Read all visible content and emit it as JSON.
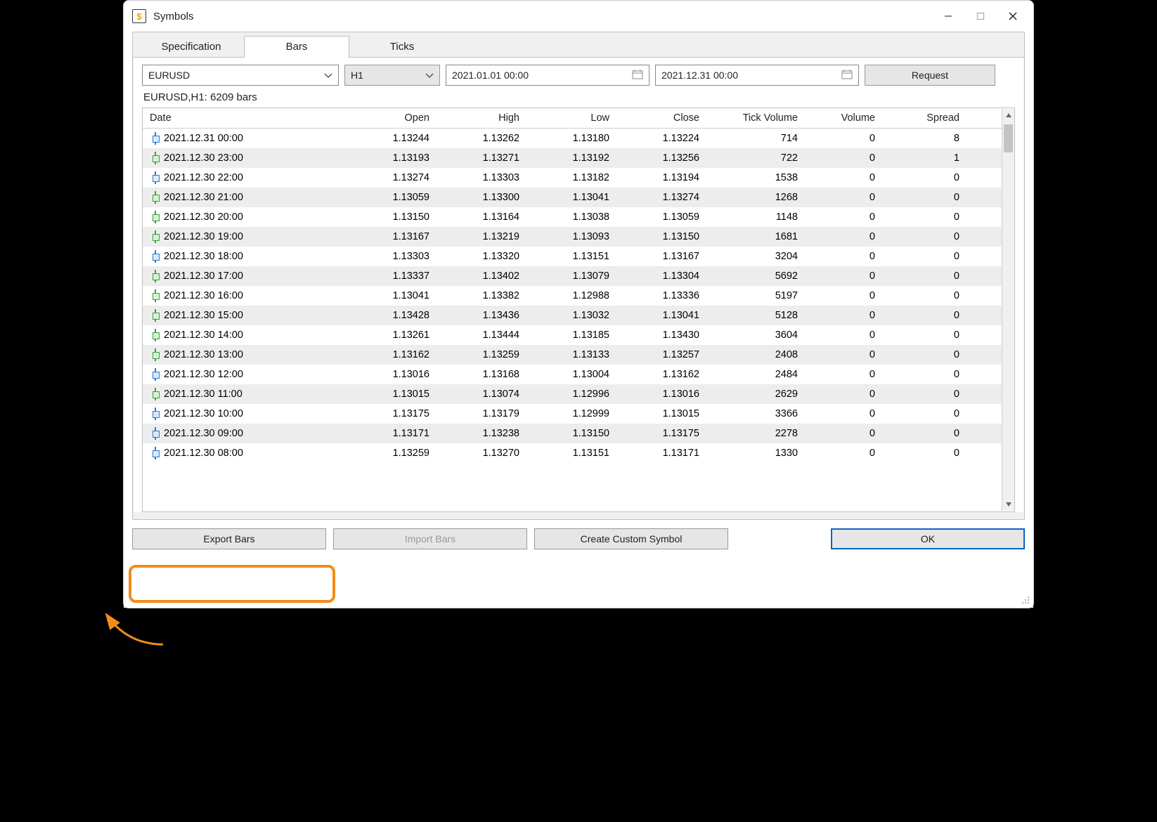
{
  "window": {
    "title": "Symbols"
  },
  "tabs": [
    {
      "label": "Specification",
      "active": false
    },
    {
      "label": "Bars",
      "active": true
    },
    {
      "label": "Ticks",
      "active": false
    }
  ],
  "filters": {
    "symbol": "EURUSD",
    "timeframe": "H1",
    "from": "2021.01.01 00:00",
    "to": "2021.12.31 00:00",
    "request_label": "Request"
  },
  "status_line": "EURUSD,H1: 6209 bars",
  "columns": [
    "Date",
    "Open",
    "High",
    "Low",
    "Close",
    "Tick Volume",
    "Volume",
    "Spread"
  ],
  "rows": [
    {
      "dir": "down",
      "date": "2021.12.31 00:00",
      "open": "1.13244",
      "high": "1.13262",
      "low": "1.13180",
      "close": "1.13224",
      "tv": "714",
      "vol": "0",
      "spr": "8"
    },
    {
      "dir": "up",
      "date": "2021.12.30 23:00",
      "open": "1.13193",
      "high": "1.13271",
      "low": "1.13192",
      "close": "1.13256",
      "tv": "722",
      "vol": "0",
      "spr": "1"
    },
    {
      "dir": "down",
      "date": "2021.12.30 22:00",
      "open": "1.13274",
      "high": "1.13303",
      "low": "1.13182",
      "close": "1.13194",
      "tv": "1538",
      "vol": "0",
      "spr": "0"
    },
    {
      "dir": "up",
      "date": "2021.12.30 21:00",
      "open": "1.13059",
      "high": "1.13300",
      "low": "1.13041",
      "close": "1.13274",
      "tv": "1268",
      "vol": "0",
      "spr": "0"
    },
    {
      "dir": "up",
      "date": "2021.12.30 20:00",
      "open": "1.13150",
      "high": "1.13164",
      "low": "1.13038",
      "close": "1.13059",
      "tv": "1148",
      "vol": "0",
      "spr": "0"
    },
    {
      "dir": "up",
      "date": "2021.12.30 19:00",
      "open": "1.13167",
      "high": "1.13219",
      "low": "1.13093",
      "close": "1.13150",
      "tv": "1681",
      "vol": "0",
      "spr": "0"
    },
    {
      "dir": "down",
      "date": "2021.12.30 18:00",
      "open": "1.13303",
      "high": "1.13320",
      "low": "1.13151",
      "close": "1.13167",
      "tv": "3204",
      "vol": "0",
      "spr": "0"
    },
    {
      "dir": "up",
      "date": "2021.12.30 17:00",
      "open": "1.13337",
      "high": "1.13402",
      "low": "1.13079",
      "close": "1.13304",
      "tv": "5692",
      "vol": "0",
      "spr": "0"
    },
    {
      "dir": "up",
      "date": "2021.12.30 16:00",
      "open": "1.13041",
      "high": "1.13382",
      "low": "1.12988",
      "close": "1.13336",
      "tv": "5197",
      "vol": "0",
      "spr": "0"
    },
    {
      "dir": "up",
      "date": "2021.12.30 15:00",
      "open": "1.13428",
      "high": "1.13436",
      "low": "1.13032",
      "close": "1.13041",
      "tv": "5128",
      "vol": "0",
      "spr": "0"
    },
    {
      "dir": "up",
      "date": "2021.12.30 14:00",
      "open": "1.13261",
      "high": "1.13444",
      "low": "1.13185",
      "close": "1.13430",
      "tv": "3604",
      "vol": "0",
      "spr": "0"
    },
    {
      "dir": "up",
      "date": "2021.12.30 13:00",
      "open": "1.13162",
      "high": "1.13259",
      "low": "1.13133",
      "close": "1.13257",
      "tv": "2408",
      "vol": "0",
      "spr": "0"
    },
    {
      "dir": "down",
      "date": "2021.12.30 12:00",
      "open": "1.13016",
      "high": "1.13168",
      "low": "1.13004",
      "close": "1.13162",
      "tv": "2484",
      "vol": "0",
      "spr": "0"
    },
    {
      "dir": "up",
      "date": "2021.12.30 11:00",
      "open": "1.13015",
      "high": "1.13074",
      "low": "1.12996",
      "close": "1.13016",
      "tv": "2629",
      "vol": "0",
      "spr": "0"
    },
    {
      "dir": "down",
      "date": "2021.12.30 10:00",
      "open": "1.13175",
      "high": "1.13179",
      "low": "1.12999",
      "close": "1.13015",
      "tv": "3366",
      "vol": "0",
      "spr": "0"
    },
    {
      "dir": "down",
      "date": "2021.12.30 09:00",
      "open": "1.13171",
      "high": "1.13238",
      "low": "1.13150",
      "close": "1.13175",
      "tv": "2278",
      "vol": "0",
      "spr": "0"
    },
    {
      "dir": "down",
      "date": "2021.12.30 08:00",
      "open": "1.13259",
      "high": "1.13270",
      "low": "1.13151",
      "close": "1.13171",
      "tv": "1330",
      "vol": "0",
      "spr": "0"
    }
  ],
  "buttons": {
    "export": "Export Bars",
    "import": "Import Bars",
    "create": "Create Custom Symbol",
    "ok": "OK"
  }
}
